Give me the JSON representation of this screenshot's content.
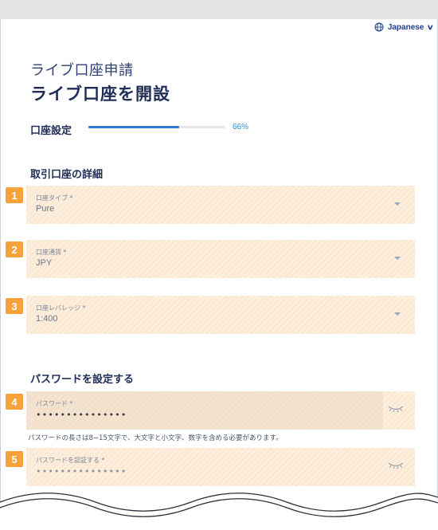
{
  "language": {
    "label": "Japanese"
  },
  "header": {
    "subtitle": "ライブ口座申請",
    "title": "ライブ口座を開設"
  },
  "progress": {
    "label": "口座設定",
    "percent_text": "66%",
    "value": 0.66
  },
  "account_section": {
    "title": "取引口座の詳細",
    "fields": [
      {
        "badge": "1",
        "label": "口座タイプ *",
        "value": "Pure"
      },
      {
        "badge": "2",
        "label": "口座通貨 *",
        "value": "JPY"
      },
      {
        "badge": "3",
        "label": "口座レバレッジ *",
        "value": "1:400"
      }
    ]
  },
  "password_section": {
    "title": "パスワードを設定する",
    "password": {
      "badge": "4",
      "label": "パスワード *",
      "value": "•••••••••••••••"
    },
    "hint": "パスワードの長さは8−15文字で、大文字と小文字、数字を含める必要があります。",
    "confirm": {
      "badge": "5",
      "label": "パスワードを認証する *",
      "value": "•••••••••••••••"
    }
  },
  "colors": {
    "accent": "#2b78d0",
    "badge": "#f5a23b",
    "field_highlight": "#fbe9d3",
    "text_dark": "#1f2d56"
  }
}
